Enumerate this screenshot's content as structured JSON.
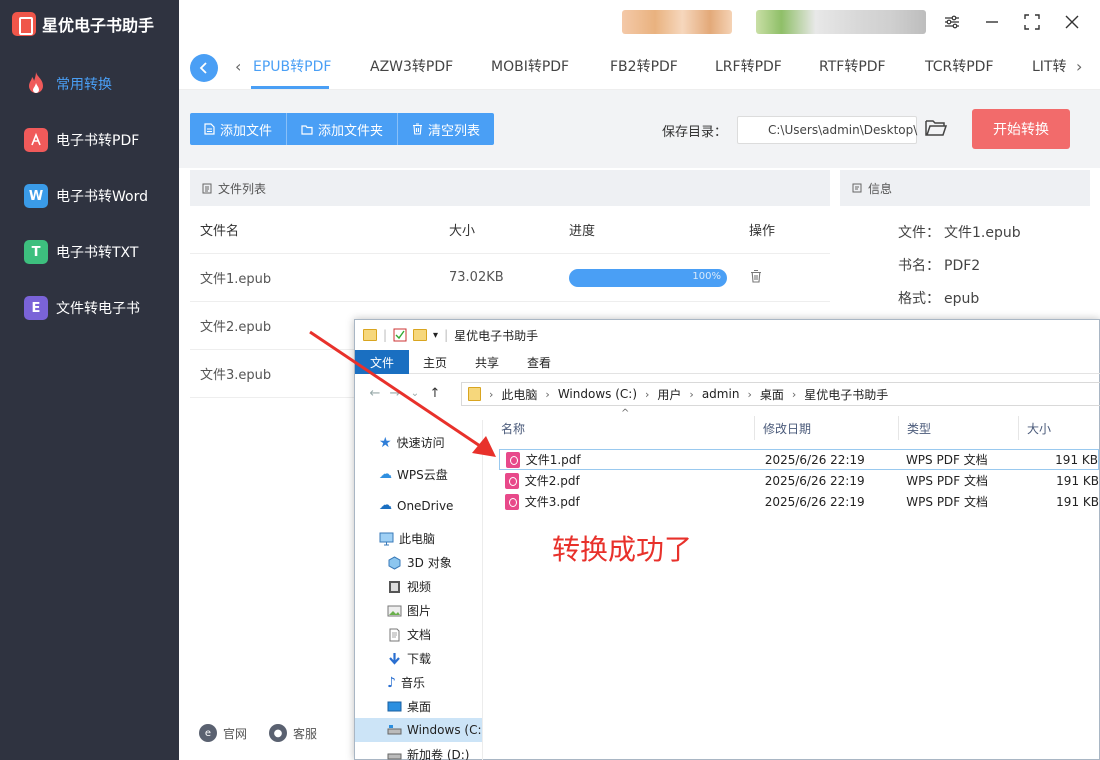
{
  "app": {
    "title": "星优电子书助手"
  },
  "sidebar": {
    "items": [
      {
        "label": "常用转换",
        "icon": "fire-icon",
        "active": true
      },
      {
        "label": "电子书转PDF",
        "icon": "pdf-icon",
        "color": "#f05a5a"
      },
      {
        "label": "电子书转Word",
        "icon": "word-icon",
        "color": "#3a9be8",
        "letter": "W"
      },
      {
        "label": "电子书转TXT",
        "icon": "txt-icon",
        "color": "#3dbf7e",
        "letter": "T"
      },
      {
        "label": "文件转电子书",
        "icon": "ebook-icon",
        "color": "#7a63d8",
        "letter": "E"
      }
    ]
  },
  "tabs": [
    "EPUB转PDF",
    "AZW3转PDF",
    "MOBI转PDF",
    "FB2转PDF",
    "LRF转PDF",
    "RTF转PDF",
    "TCR转PDF",
    "LIT转"
  ],
  "toolbar": {
    "add_file": "添加文件",
    "add_folder": "添加文件夹",
    "clear_list": "清空列表",
    "save_label": "保存目录：",
    "save_path": "C:\\Users\\admin\\Desktop\\",
    "start": "开始转换"
  },
  "file_list": {
    "title": "文件列表",
    "columns": {
      "name": "文件名",
      "size": "大小",
      "progress": "进度",
      "action": "操作"
    },
    "rows": [
      {
        "name": "文件1.epub",
        "size": "73.02KB",
        "progress": "100%",
        "progress_value": 100
      },
      {
        "name": "文件2.epub"
      },
      {
        "name": "文件3.epub"
      }
    ]
  },
  "info": {
    "title": "信息",
    "file_label": "文件：",
    "file_value": "文件1.epub",
    "book_label": "书名：",
    "book_value": "PDF2",
    "format_label": "格式：",
    "format_value": "epub"
  },
  "footer": {
    "website": "官网",
    "support": "客服"
  },
  "explorer": {
    "title": "星优电子书助手",
    "ribbon": [
      "文件",
      "主页",
      "共享",
      "查看"
    ],
    "breadcrumb": [
      "此电脑",
      "Windows (C:)",
      "用户",
      "admin",
      "桌面",
      "星优电子书助手"
    ],
    "nav": [
      {
        "label": "快速访问",
        "icon": "star-icon"
      },
      {
        "label": "WPS云盘",
        "icon": "cloud-icon"
      },
      {
        "label": "OneDrive",
        "icon": "onedrive-icon"
      },
      {
        "label": "此电脑",
        "icon": "computer-icon"
      },
      {
        "label": "3D 对象",
        "icon": "cube-icon"
      },
      {
        "label": "视频",
        "icon": "video-icon"
      },
      {
        "label": "图片",
        "icon": "picture-icon"
      },
      {
        "label": "文档",
        "icon": "document-icon"
      },
      {
        "label": "下载",
        "icon": "download-icon"
      },
      {
        "label": "音乐",
        "icon": "music-icon"
      },
      {
        "label": "桌面",
        "icon": "desktop-icon"
      },
      {
        "label": "Windows (C:",
        "icon": "drive-icon"
      },
      {
        "label": "新加卷 (D:)",
        "icon": "drive-icon"
      }
    ],
    "columns": {
      "name": "名称",
      "date": "修改日期",
      "type": "类型",
      "size": "大小"
    },
    "files": [
      {
        "name": "文件1.pdf",
        "date": "2025/6/26 22:19",
        "type": "WPS PDF 文档",
        "size": "191 KB"
      },
      {
        "name": "文件2.pdf",
        "date": "2025/6/26 22:19",
        "type": "WPS PDF 文档",
        "size": "191 KB"
      },
      {
        "name": "文件3.pdf",
        "date": "2025/6/26 22:19",
        "type": "WPS PDF 文档",
        "size": "191 KB"
      }
    ]
  },
  "annotation": {
    "text": "转换成功了",
    "color": "#e8312b"
  }
}
